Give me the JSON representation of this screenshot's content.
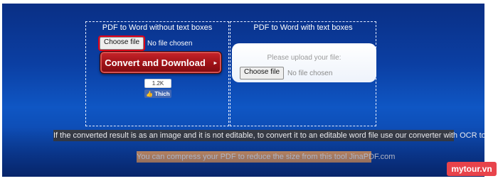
{
  "left_panel": {
    "title": "PDF to Word without text boxes",
    "choose_file_label": "Choose file",
    "no_file_text": "No file chosen",
    "convert_label": "Convert and Download",
    "convert_arrow": "▸",
    "like_count": "1.2K",
    "like_label": "Thich"
  },
  "right_panel": {
    "title": "PDF to Word with text boxes",
    "upload_prompt": "Please upload your file:",
    "choose_file_label": "Choose file",
    "no_file_text": "No file chosen"
  },
  "info_text": "If the converted result is as an image and it is not editable, to convert it to an editable word file use our converter with OCR tool.",
  "compress_text": "You can compress your PDF to reduce the size from this tool JinaPDF.com",
  "watermark": "mytour.vn",
  "colors": {
    "background": "#0b3fa3",
    "convert_button": "#9e1217",
    "highlight_outline": "#e0001a",
    "info_bar": "#3a3d44",
    "compress_bar": "#f2a96b",
    "like_button": "#4267b2",
    "watermark": "#e8434b"
  },
  "icons": {
    "thumb": "thumbs-up-icon",
    "arrow": "arrow-right-icon"
  }
}
